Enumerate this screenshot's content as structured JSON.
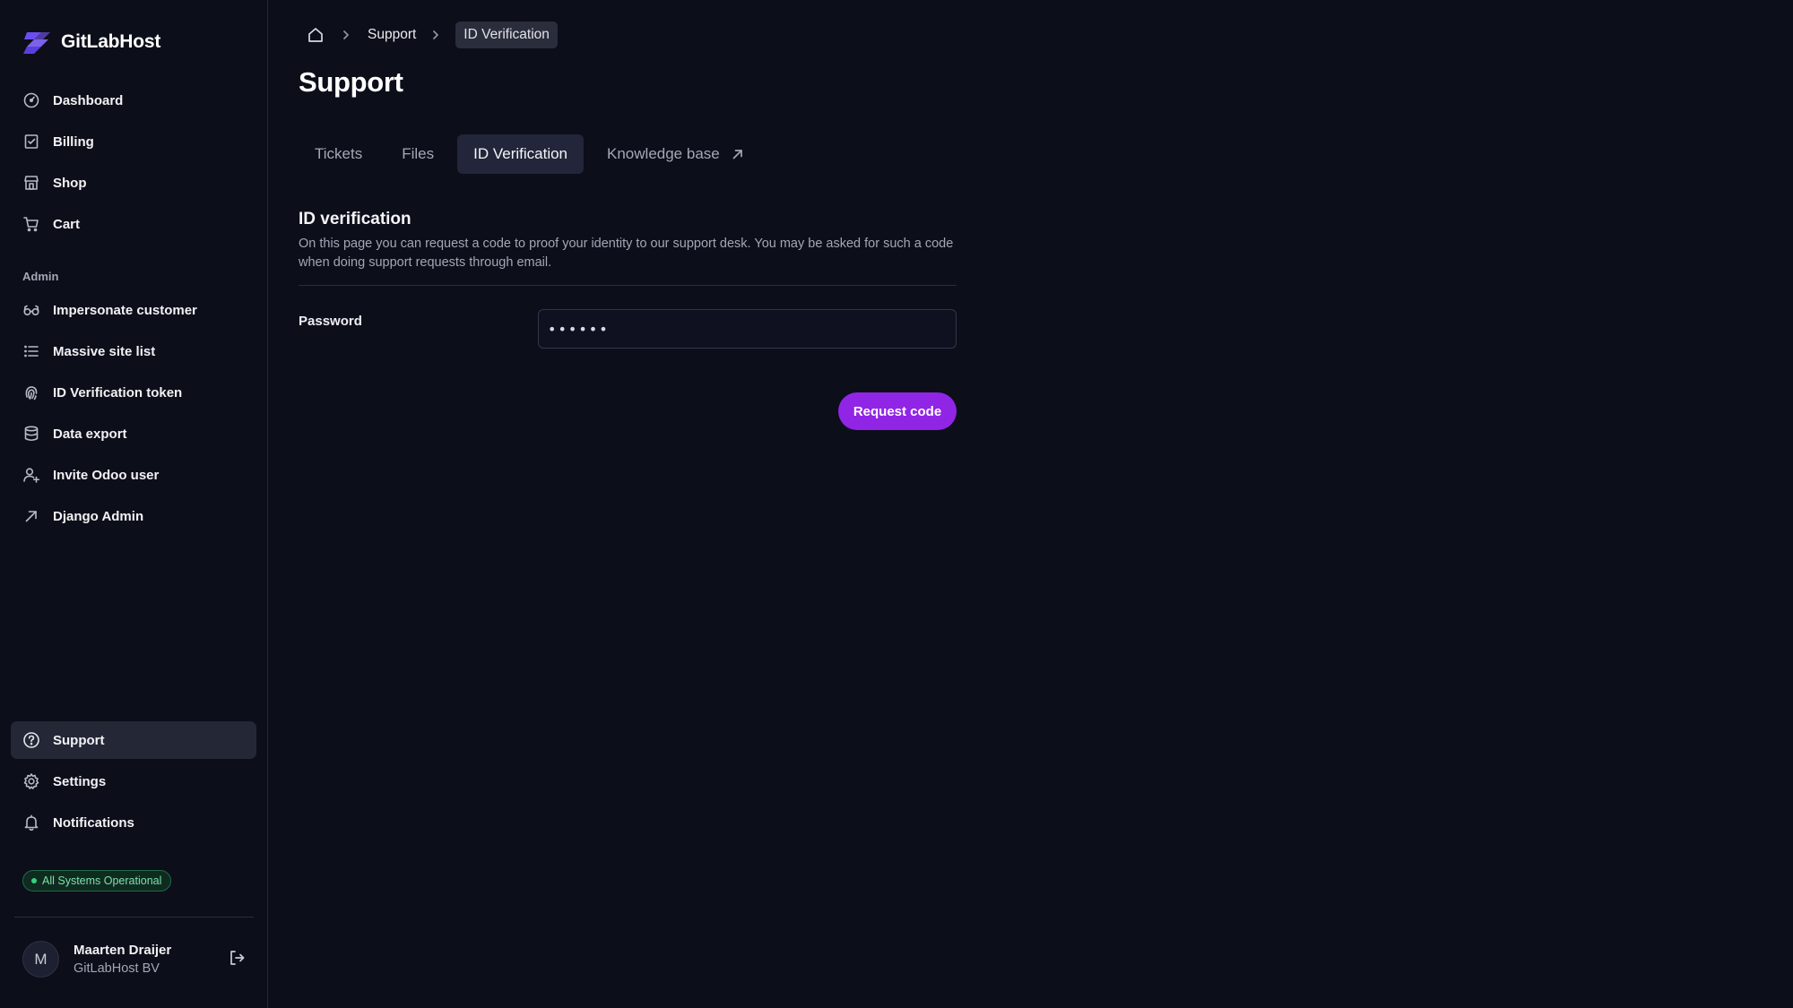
{
  "app": {
    "name": "GitLabHost"
  },
  "sidebar": {
    "main_items": [
      {
        "label": "Dashboard",
        "icon": "dashboard-gauge-icon"
      },
      {
        "label": "Billing",
        "icon": "billing-receipt-icon"
      },
      {
        "label": "Shop",
        "icon": "shop-storefront-icon"
      },
      {
        "label": "Cart",
        "icon": "cart-icon"
      }
    ],
    "admin_label": "Admin",
    "admin_items": [
      {
        "label": "Impersonate customer",
        "icon": "glasses-icon"
      },
      {
        "label": "Massive site list",
        "icon": "list-icon"
      },
      {
        "label": "ID Verification token",
        "icon": "fingerprint-icon"
      },
      {
        "label": "Data export",
        "icon": "database-icon"
      },
      {
        "label": "Invite Odoo user",
        "icon": "user-plus-icon"
      },
      {
        "label": "Django Admin",
        "icon": "arrow-up-right-icon"
      }
    ],
    "bottom_items": [
      {
        "label": "Support",
        "icon": "question-circle-icon",
        "active": true
      },
      {
        "label": "Settings",
        "icon": "gear-icon"
      },
      {
        "label": "Notifications",
        "icon": "bell-icon"
      }
    ],
    "status": {
      "label": "All Systems Operational",
      "color": "#34d27b"
    },
    "user": {
      "initial": "M",
      "name": "Maarten Draijer",
      "org": "GitLabHost BV"
    }
  },
  "breadcrumb": {
    "items": [
      "Support"
    ],
    "current": "ID Verification"
  },
  "page": {
    "title": "Support",
    "tabs": [
      {
        "label": "Tickets"
      },
      {
        "label": "Files"
      },
      {
        "label": "ID Verification",
        "active": true
      },
      {
        "label": "Knowledge base",
        "external": true
      }
    ],
    "section_title": "ID verification",
    "section_desc": "On this page you can request a code to proof your identity to our support desk. You may be asked for such a code when doing support requests through email.",
    "password_label": "Password",
    "password_value": "••••••",
    "submit_label": "Request code"
  },
  "colors": {
    "accent": "#9125e6",
    "background": "#0c0e1a",
    "active_nav": "#242736"
  }
}
